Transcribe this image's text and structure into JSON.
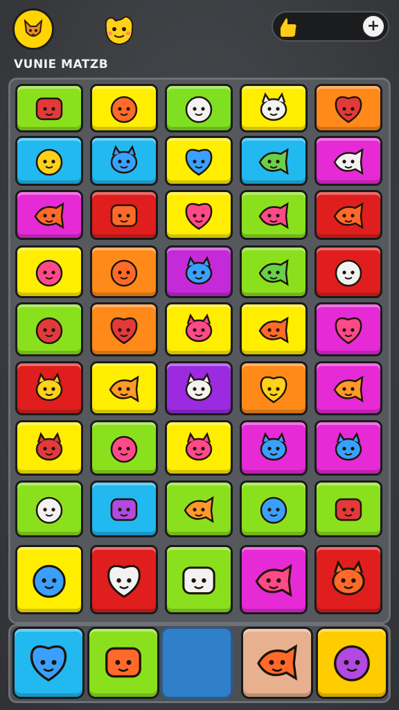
{
  "header": {
    "title": "VUNIE MATZB",
    "avatar_icon": "fox-face-icon",
    "secondary_icon": "smiley-face-icon",
    "currency_icon": "coin-hand-icon",
    "currency_amount": "",
    "add_button_symbol": "+"
  },
  "board": {
    "rows": 9,
    "cols": 5,
    "tiles": [
      [
        "leaf-icon",
        "red-cat-icon",
        "blue-fish-icon",
        "paint-brush-icon",
        "flag-icon"
      ],
      [
        "orange-fruit-icon",
        "pink-leaf-icon",
        "yellow-cat-icon",
        "yellow-fish-icon",
        "sunglasses-face-icon"
      ],
      [
        "yellow-bird-icon",
        "sunglasses-icon",
        "crossed-tools-icon",
        "pink-dinosaur-icon",
        "wrench-icon"
      ],
      [
        "green-monster-icon",
        "orange-bear-icon",
        "purple-moon-star-icon",
        "pink-pig-icon",
        "paint-tube-icon"
      ],
      [
        "purple-fish-icon",
        "blue-creature-icon",
        "pink-fish-icon",
        "yellow-dog-icon",
        "house-icon"
      ],
      [
        "orange-fish-icon",
        "yellow-lemon-icon",
        "pretzel-icon",
        "green-blob-icon",
        "orange-bear-face-icon"
      ],
      [
        "mushroom-icon",
        "boy-face-icon",
        "orange-leaf-icon",
        "orange-cat-icon",
        "chef-face-icon"
      ],
      [
        "apple-icon",
        "shell-icon",
        "heart-icon",
        "burger-icon",
        "banana-icon"
      ],
      [
        "blue-crocodile-icon",
        "fox-face-icon",
        "game-console-icon",
        "white-cat-icon",
        "camera-icon"
      ]
    ],
    "colors": [
      [
        "#8be01e",
        "#ffee00",
        "#7fe022",
        "#ffee00",
        "#ff8a1a"
      ],
      [
        "#22b8f0",
        "#22b8f0",
        "#ffee00",
        "#22b8f0",
        "#e62ad6"
      ],
      [
        "#e62ad6",
        "#e01e1e",
        "#ffee00",
        "#8be01e",
        "#e01e1e"
      ],
      [
        "#ffee00",
        "#ff8a1a",
        "#c42ad8",
        "#8be01e",
        "#e01e1e"
      ],
      [
        "#8be01e",
        "#ff8a1a",
        "#ffee00",
        "#ffee00",
        "#e62ad6"
      ],
      [
        "#e01e1e",
        "#ffee00",
        "#9b2ae0",
        "#ff8a1a",
        "#e62ad6"
      ],
      [
        "#ffee00",
        "#8be01e",
        "#ffee00",
        "#e62ad6",
        "#e62ad6"
      ],
      [
        "#8be01e",
        "#22b8f0",
        "#8be01e",
        "#8be01e",
        "#8be01e"
      ],
      [
        "#ffee00",
        "#e01e1e",
        "#8be01e",
        "#e62ad6",
        "#e01e1e"
      ]
    ]
  },
  "tray": {
    "slots": [
      {
        "icon": "yellow-bear-icon",
        "color": "#22b8f0"
      },
      {
        "icon": "pink-cat-glasses-icon",
        "color": "#8be01e"
      },
      {
        "icon": "",
        "color": "#2f7fc9"
      },
      {
        "icon": "oven-icon",
        "color": "#e7b08e"
      },
      {
        "icon": "red-robot-icon",
        "color": "#ffcc00"
      }
    ]
  }
}
